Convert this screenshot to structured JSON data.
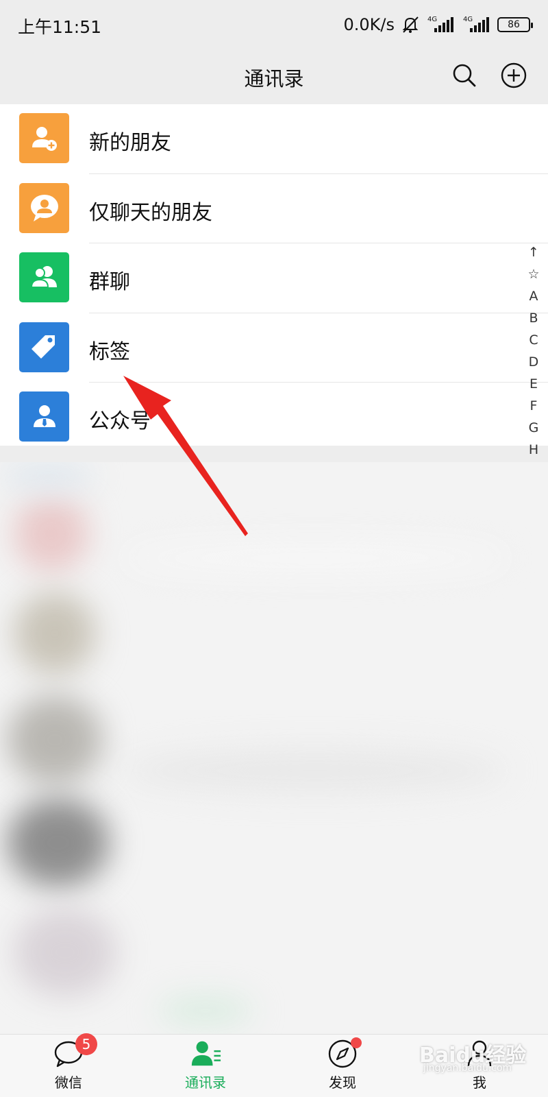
{
  "status_bar": {
    "time": "上午11:51",
    "net_speed": "0.0K/s",
    "battery": "86",
    "icons": [
      "mute-bell-icon",
      "signal-4g-icon",
      "signal-4g-icon",
      "battery-icon"
    ]
  },
  "nav": {
    "title": "通讯录",
    "icons": [
      "search-icon",
      "add-circle-icon"
    ]
  },
  "functions": [
    {
      "label": "新的朋友",
      "icon": "new-friend-icon",
      "color": "#f7a03d"
    },
    {
      "label": "仅聊天的朋友",
      "icon": "chat-only-icon",
      "color": "#f7a03d"
    },
    {
      "label": "群聊",
      "icon": "group-chat-icon",
      "color": "#17bf62"
    },
    {
      "label": "标签",
      "icon": "tag-icon",
      "color": "#2c7fd9"
    },
    {
      "label": "公众号",
      "icon": "official-account-icon",
      "color": "#2c7fd9"
    }
  ],
  "index_bar": [
    "↑",
    "☆",
    "A",
    "B",
    "C",
    "D",
    "E",
    "F",
    "G",
    "H"
  ],
  "tabs": [
    {
      "label": "微信",
      "icon": "chat-bubble-icon",
      "badge": "5",
      "active": false
    },
    {
      "label": "通讯录",
      "icon": "contacts-icon",
      "active": true
    },
    {
      "label": "发现",
      "icon": "compass-icon",
      "dot": true,
      "active": false
    },
    {
      "label": "我",
      "icon": "person-icon",
      "active": false
    }
  ],
  "watermark": {
    "text": "Baidu经验",
    "sub": "jingyan.baidu.com"
  },
  "colors": {
    "accent": "#1aad5a",
    "badge": "#f04848",
    "annotation_arrow": "#e8231f"
  }
}
